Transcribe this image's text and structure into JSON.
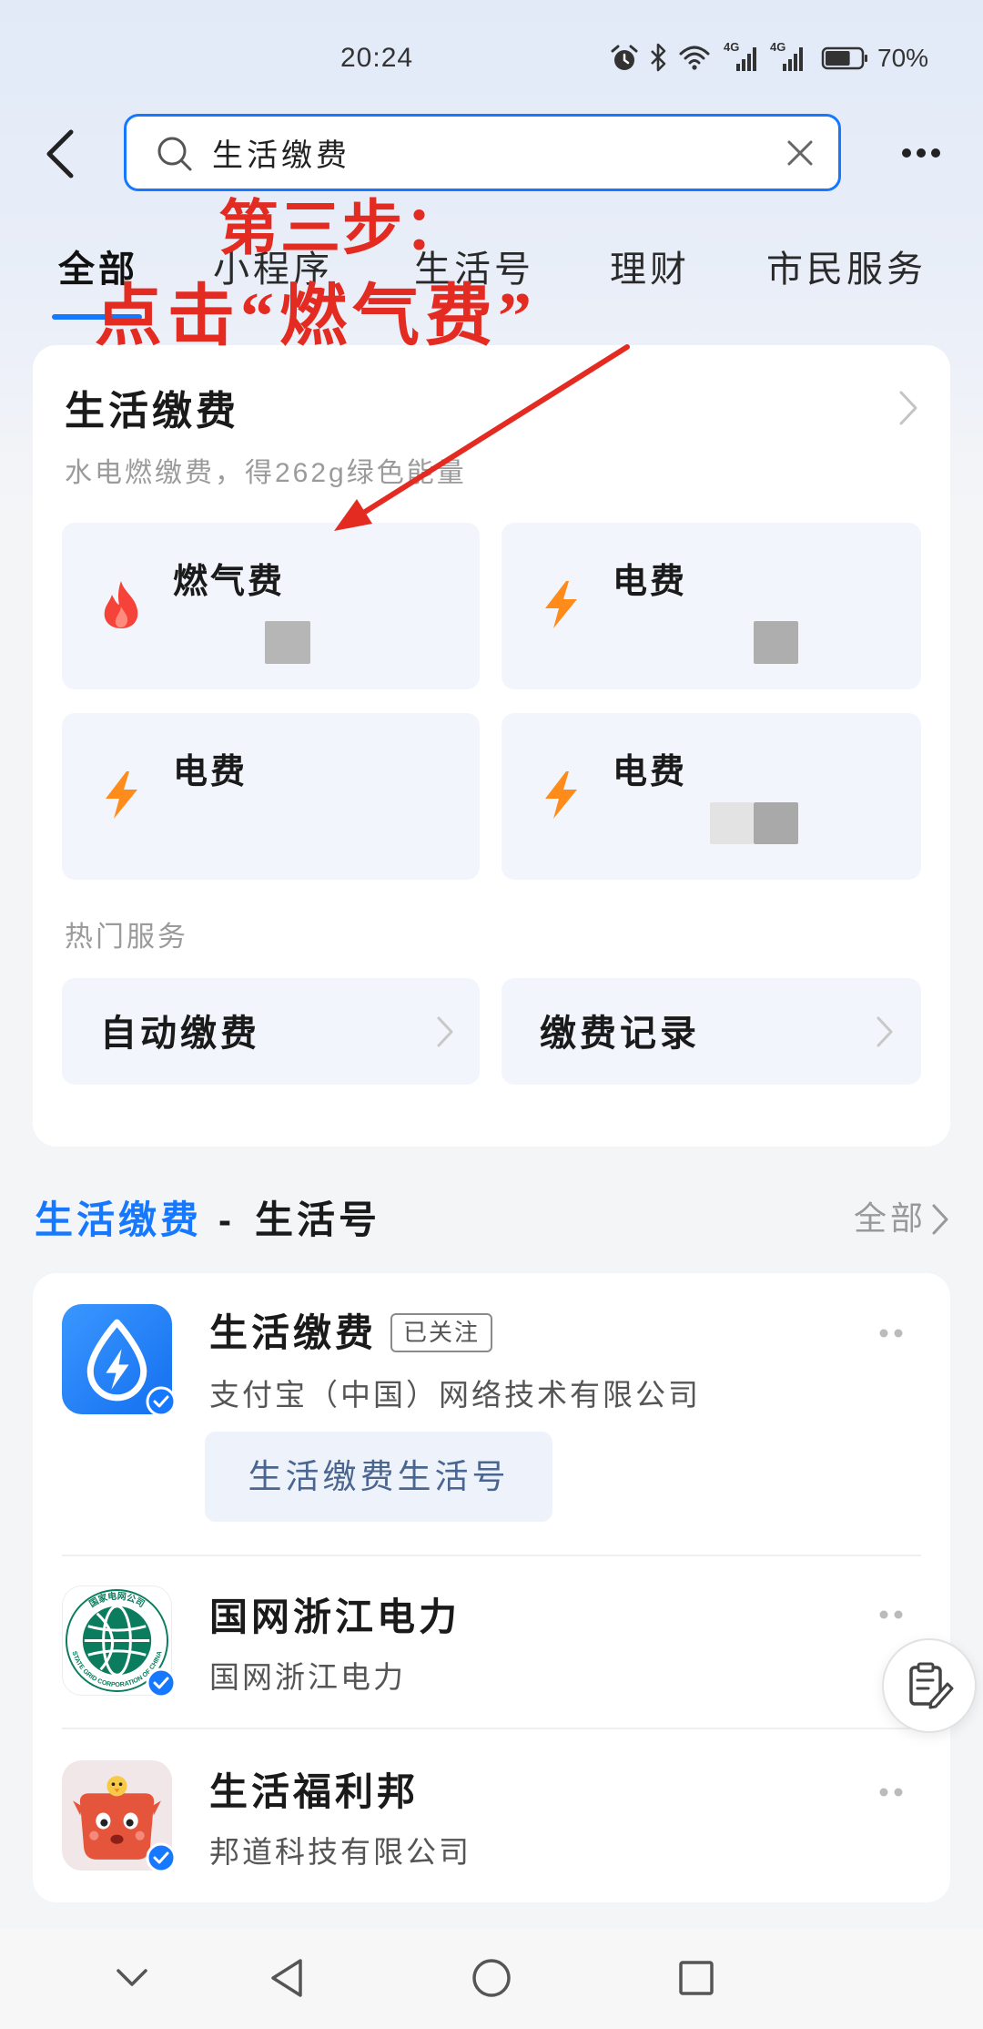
{
  "status_bar": {
    "time": "20:24",
    "network_1": "4G",
    "network_2": "4G",
    "battery": "70%",
    "battery_level": 0.7
  },
  "search": {
    "value": "生活缴费"
  },
  "tabs": [
    {
      "label": "全部",
      "active": true
    },
    {
      "label": "小程序",
      "active": false
    },
    {
      "label": "生活号",
      "active": false
    },
    {
      "label": "理财",
      "active": false
    },
    {
      "label": "市民服务",
      "active": false
    }
  ],
  "annotation": {
    "step": "第三步：",
    "instruction": "点击“燃气费”"
  },
  "payment_card": {
    "title": "生活缴费",
    "subtitle": "水电燃缴费，得262g绿色能量",
    "tiles": [
      {
        "label": "燃气费",
        "icon": "flame-icon"
      },
      {
        "label": "电费",
        "icon": "lightning-icon"
      },
      {
        "label": "电费",
        "icon": "lightning-icon"
      },
      {
        "label": "电费",
        "icon": "lightning-icon"
      }
    ],
    "hot_services_label": "热门服务",
    "hot_services": [
      {
        "label": "自动缴费"
      },
      {
        "label": "缴费记录"
      }
    ]
  },
  "section": {
    "highlight": "生活缴费",
    "separator": "-",
    "rest": "生活号",
    "more_label": "全部"
  },
  "accounts": [
    {
      "name": "生活缴费",
      "badge": "已关注",
      "org": "支付宝（中国）网络技术有限公司",
      "link": "生活缴费生活号",
      "avatar": "water-lightning-logo",
      "verified": true
    },
    {
      "name": "国网浙江电力",
      "org": "国网浙江电力",
      "avatar": "state-grid-logo",
      "logo_text_cn": "国家电网公司",
      "logo_text_en": "STATE GRID CORPORATION OF CHINA",
      "verified": true
    },
    {
      "name": "生活福利邦",
      "org": "邦道科技有限公司",
      "avatar": "mascot-avatar",
      "verified": true
    }
  ],
  "colors": {
    "accent": "#1677ff",
    "annotation": "#e42b22",
    "flame": "#f5433a",
    "lightning": "#ff8c1a",
    "tile_background": "#f2f5fc"
  }
}
